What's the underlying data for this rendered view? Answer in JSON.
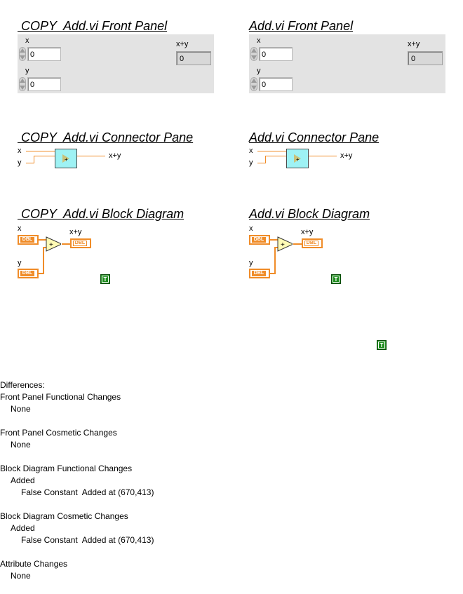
{
  "left": {
    "front_panel_title": " COPY  Add.vi Front Panel",
    "connector_title": " COPY  Add.vi Connector Pane",
    "block_title": " COPY  Add.vi Block Diagram"
  },
  "right": {
    "front_panel_title": "Add.vi Front Panel",
    "connector_title": "Add.vi Connector Pane",
    "block_title": "Add.vi Block Diagram"
  },
  "labels": {
    "x": "x",
    "y": "y",
    "sum": "x+y",
    "dbl": "DBL",
    "true_const": "T"
  },
  "values": {
    "x": "0",
    "y": "0",
    "sum": "0"
  },
  "differences": {
    "header": "Differences:",
    "sections": [
      {
        "title": "Front Panel Functional Changes",
        "lines": [
          "None"
        ]
      },
      {
        "title": "Front Panel Cosmetic Changes",
        "lines": [
          "None"
        ]
      },
      {
        "title": "Block Diagram Functional Changes",
        "lines": [
          "Added",
          "False Constant  Added at (670,413)"
        ]
      },
      {
        "title": "Block Diagram Cosmetic Changes",
        "lines": [
          "Added",
          "False Constant  Added at (670,413)"
        ]
      },
      {
        "title": "Attribute Changes",
        "lines": [
          "None"
        ]
      }
    ]
  },
  "colors": {
    "wire": "#f08c28",
    "connector": "#9ef2f4",
    "true_const": "#1e8c1e",
    "panel_bg": "#e3e3e3"
  }
}
